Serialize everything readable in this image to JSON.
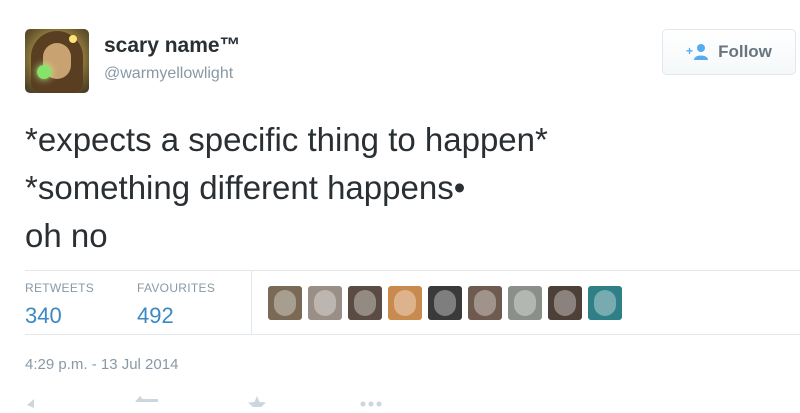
{
  "user": {
    "display_name": "scary name™",
    "handle": "@warmyellowlight",
    "avatar_icon": "profile-avatar"
  },
  "follow": {
    "label": "Follow",
    "icon": "add-user-icon",
    "icon_color": "#55acee"
  },
  "tweet": {
    "lines": [
      "*expects a specific thing to happen*",
      "*something different happens•",
      "oh no"
    ]
  },
  "stats": {
    "retweets": {
      "label": "RETWEETS",
      "value": "340"
    },
    "favourites": {
      "label": "FAVOURITES",
      "value": "492"
    }
  },
  "favouriters": [
    {
      "name": "favouriter-avatar-1",
      "color": "#7a6a55"
    },
    {
      "name": "favouriter-avatar-2",
      "color": "#9a8f86"
    },
    {
      "name": "favouriter-avatar-3",
      "color": "#5b4c43"
    },
    {
      "name": "favouriter-avatar-4",
      "color": "#c98a4f"
    },
    {
      "name": "favouriter-avatar-5",
      "color": "#3a3a3a"
    },
    {
      "name": "favouriter-avatar-6",
      "color": "#6e5a4e"
    },
    {
      "name": "favouriter-avatar-7",
      "color": "#8b8f8a"
    },
    {
      "name": "favouriter-avatar-8",
      "color": "#4d4038"
    },
    {
      "name": "favouriter-avatar-9",
      "color": "#2e7f86"
    }
  ],
  "timestamp": "4:29 p.m. - 13 Jul 2014",
  "colors": {
    "link_blue": "#3b88c3",
    "muted": "#8899a6",
    "text": "#292f33"
  },
  "actions": [
    "reply-icon",
    "retweet-icon",
    "favourite-icon",
    "more-icon"
  ]
}
